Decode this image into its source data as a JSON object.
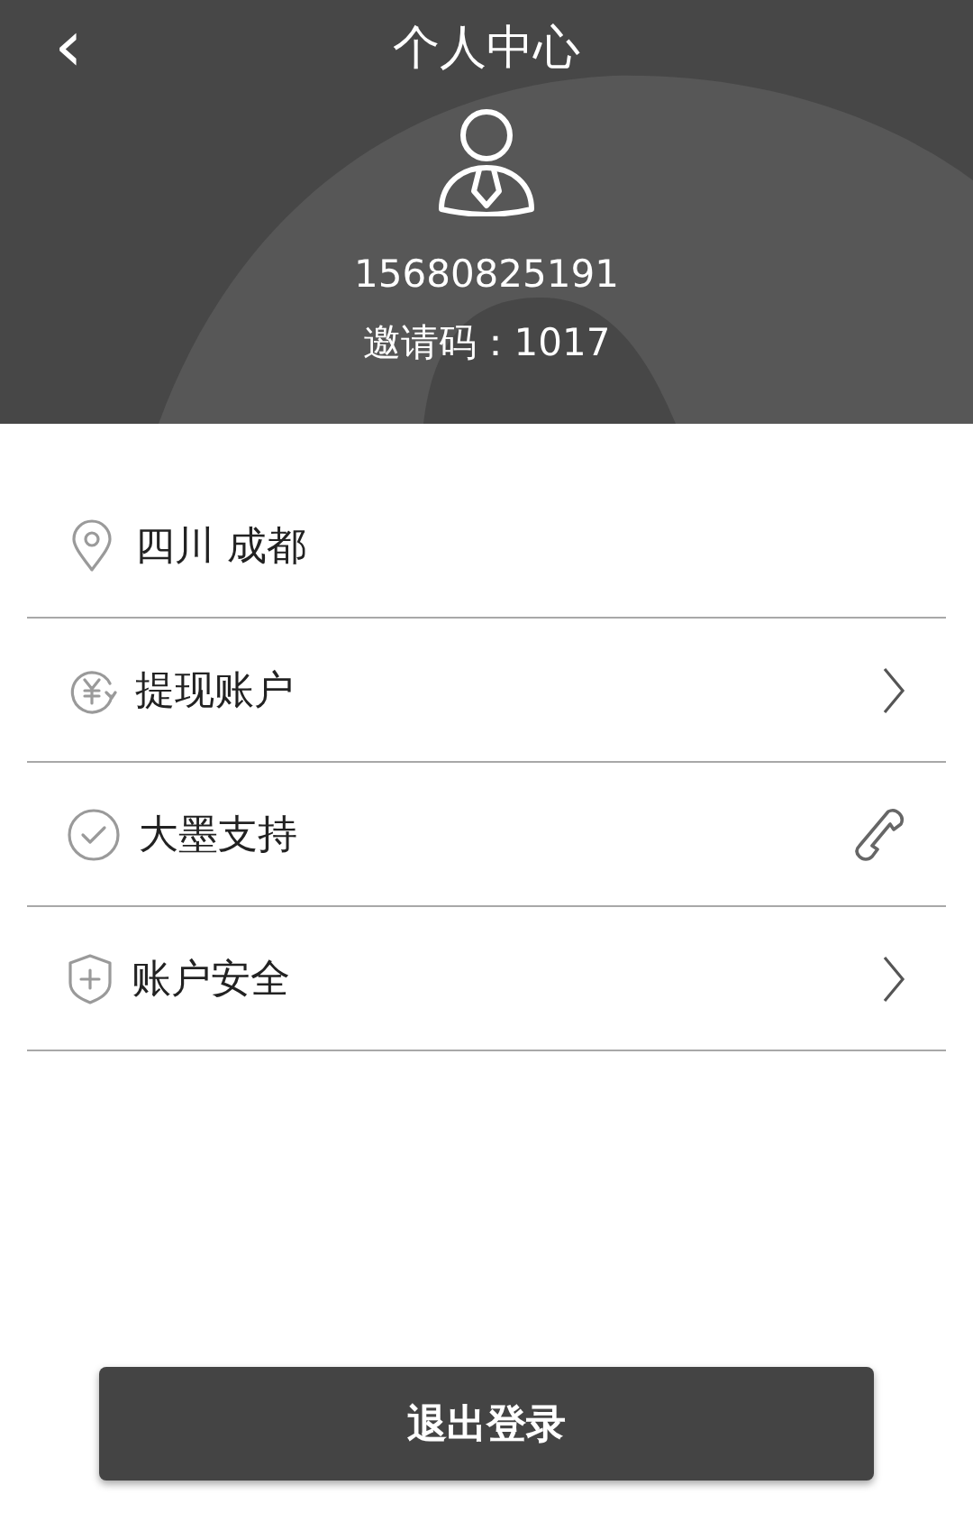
{
  "header": {
    "back": "‹",
    "title": "个人中心",
    "phone": "15680825191",
    "invite_code": "邀请码：1017"
  },
  "items": [
    {
      "label": "四川 成都",
      "kind": "info"
    },
    {
      "label": "提现账户",
      "kind": "link"
    },
    {
      "label": "大墨支持",
      "kind": "call"
    },
    {
      "label": "账户安全",
      "kind": "link"
    }
  ],
  "logout_button": "退出登录"
}
